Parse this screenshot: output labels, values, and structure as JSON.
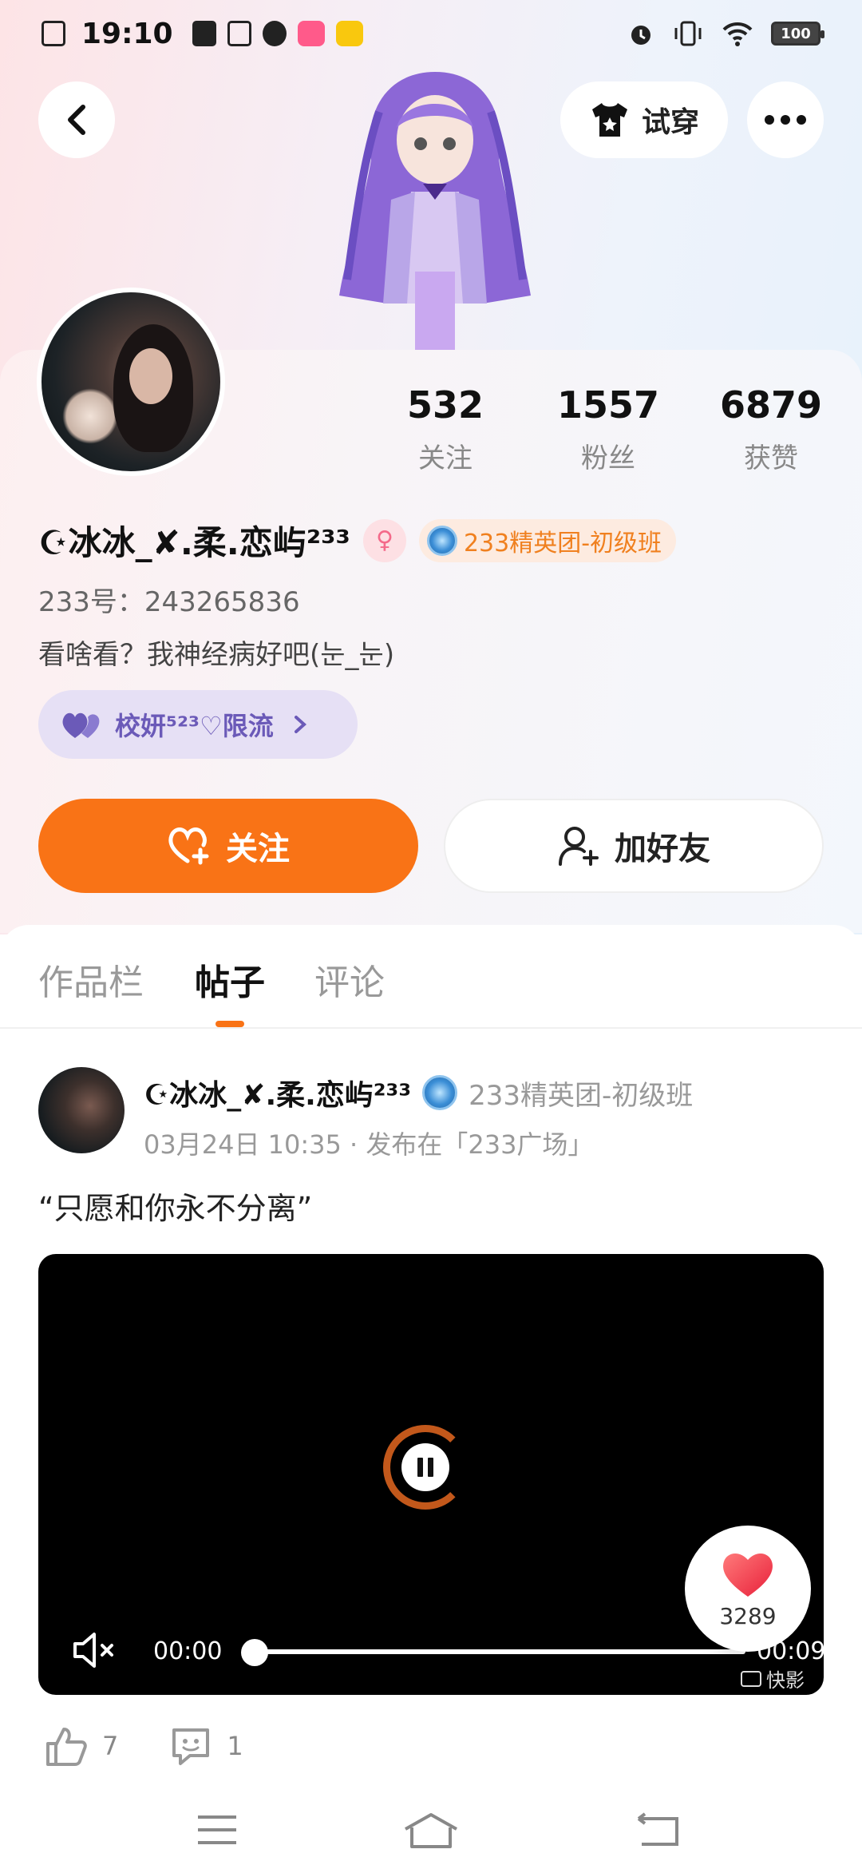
{
  "status_bar": {
    "time": "19:10",
    "battery": "100",
    "left_icons": [
      "sim-off-icon",
      "clipboard-check-icon",
      "screenshot-icon",
      "chat-bubble-icon",
      "app-pink-icon",
      "app-yellow-icon"
    ],
    "right_icons": [
      "alarm-icon",
      "vibrate-icon",
      "wifi-icon",
      "battery-icon"
    ]
  },
  "header": {
    "try_on_label": "试穿"
  },
  "profile": {
    "stats": [
      {
        "value": "532",
        "label": "关注"
      },
      {
        "value": "1557",
        "label": "粉丝"
      },
      {
        "value": "6879",
        "label": "获赞"
      }
    ],
    "name": "☪冰冰_✘.柔.恋屿²³³",
    "gender_symbol": "♀",
    "rank_badge": "233精英团-初级班",
    "id_text": "233号：243265836",
    "bio": "看啥看？我神经病好吧(눈_눈)",
    "group_chip": "校妍⁵²³♡限流",
    "follow_label": "关注",
    "add_friend_label": "加好友"
  },
  "tabs": [
    {
      "label": "作品栏",
      "active": false
    },
    {
      "label": "帖子",
      "active": true
    },
    {
      "label": "评论",
      "active": false
    }
  ],
  "post": {
    "author": "☪冰冰_✘.柔.恋屿²³³",
    "rank": "233精英团-初级班",
    "meta": "03月24日 10:35 · 发布在「233广场」",
    "text": "“只愿和你永不分离”",
    "video": {
      "current_time": "00:00",
      "total_time": "00:09",
      "progress": 0,
      "watermark": "快影"
    },
    "floating_like_count": "3289",
    "likes": "7",
    "comments": "1"
  },
  "colors": {
    "accent": "#f97316",
    "rank_text": "#f0801f",
    "group_chip_text": "#6b5ab8",
    "group_chip_bg": "#e6e0f5"
  }
}
